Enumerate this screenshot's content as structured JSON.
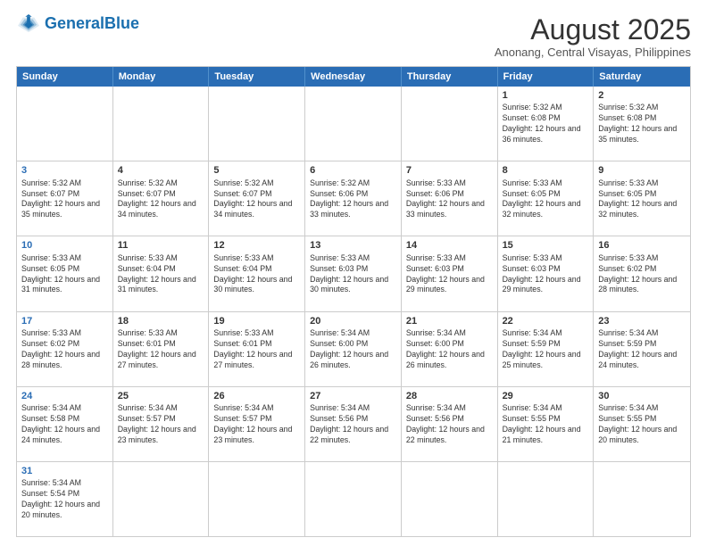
{
  "logo": {
    "text_general": "General",
    "text_blue": "Blue"
  },
  "header": {
    "month_year": "August 2025",
    "location": "Anonang, Central Visayas, Philippines"
  },
  "days_of_week": [
    "Sunday",
    "Monday",
    "Tuesday",
    "Wednesday",
    "Thursday",
    "Friday",
    "Saturday"
  ],
  "rows": [
    {
      "cells": [
        {
          "day": "",
          "info": ""
        },
        {
          "day": "",
          "info": ""
        },
        {
          "day": "",
          "info": ""
        },
        {
          "day": "",
          "info": ""
        },
        {
          "day": "",
          "info": ""
        },
        {
          "day": "1",
          "info": "Sunrise: 5:32 AM\nSunset: 6:08 PM\nDaylight: 12 hours and 36 minutes."
        },
        {
          "day": "2",
          "info": "Sunrise: 5:32 AM\nSunset: 6:08 PM\nDaylight: 12 hours and 35 minutes."
        }
      ]
    },
    {
      "cells": [
        {
          "day": "3",
          "info": "Sunrise: 5:32 AM\nSunset: 6:07 PM\nDaylight: 12 hours and 35 minutes."
        },
        {
          "day": "4",
          "info": "Sunrise: 5:32 AM\nSunset: 6:07 PM\nDaylight: 12 hours and 34 minutes."
        },
        {
          "day": "5",
          "info": "Sunrise: 5:32 AM\nSunset: 6:07 PM\nDaylight: 12 hours and 34 minutes."
        },
        {
          "day": "6",
          "info": "Sunrise: 5:32 AM\nSunset: 6:06 PM\nDaylight: 12 hours and 33 minutes."
        },
        {
          "day": "7",
          "info": "Sunrise: 5:33 AM\nSunset: 6:06 PM\nDaylight: 12 hours and 33 minutes."
        },
        {
          "day": "8",
          "info": "Sunrise: 5:33 AM\nSunset: 6:05 PM\nDaylight: 12 hours and 32 minutes."
        },
        {
          "day": "9",
          "info": "Sunrise: 5:33 AM\nSunset: 6:05 PM\nDaylight: 12 hours and 32 minutes."
        }
      ]
    },
    {
      "cells": [
        {
          "day": "10",
          "info": "Sunrise: 5:33 AM\nSunset: 6:05 PM\nDaylight: 12 hours and 31 minutes."
        },
        {
          "day": "11",
          "info": "Sunrise: 5:33 AM\nSunset: 6:04 PM\nDaylight: 12 hours and 31 minutes."
        },
        {
          "day": "12",
          "info": "Sunrise: 5:33 AM\nSunset: 6:04 PM\nDaylight: 12 hours and 30 minutes."
        },
        {
          "day": "13",
          "info": "Sunrise: 5:33 AM\nSunset: 6:03 PM\nDaylight: 12 hours and 30 minutes."
        },
        {
          "day": "14",
          "info": "Sunrise: 5:33 AM\nSunset: 6:03 PM\nDaylight: 12 hours and 29 minutes."
        },
        {
          "day": "15",
          "info": "Sunrise: 5:33 AM\nSunset: 6:03 PM\nDaylight: 12 hours and 29 minutes."
        },
        {
          "day": "16",
          "info": "Sunrise: 5:33 AM\nSunset: 6:02 PM\nDaylight: 12 hours and 28 minutes."
        }
      ]
    },
    {
      "cells": [
        {
          "day": "17",
          "info": "Sunrise: 5:33 AM\nSunset: 6:02 PM\nDaylight: 12 hours and 28 minutes."
        },
        {
          "day": "18",
          "info": "Sunrise: 5:33 AM\nSunset: 6:01 PM\nDaylight: 12 hours and 27 minutes."
        },
        {
          "day": "19",
          "info": "Sunrise: 5:33 AM\nSunset: 6:01 PM\nDaylight: 12 hours and 27 minutes."
        },
        {
          "day": "20",
          "info": "Sunrise: 5:34 AM\nSunset: 6:00 PM\nDaylight: 12 hours and 26 minutes."
        },
        {
          "day": "21",
          "info": "Sunrise: 5:34 AM\nSunset: 6:00 PM\nDaylight: 12 hours and 26 minutes."
        },
        {
          "day": "22",
          "info": "Sunrise: 5:34 AM\nSunset: 5:59 PM\nDaylight: 12 hours and 25 minutes."
        },
        {
          "day": "23",
          "info": "Sunrise: 5:34 AM\nSunset: 5:59 PM\nDaylight: 12 hours and 24 minutes."
        }
      ]
    },
    {
      "cells": [
        {
          "day": "24",
          "info": "Sunrise: 5:34 AM\nSunset: 5:58 PM\nDaylight: 12 hours and 24 minutes."
        },
        {
          "day": "25",
          "info": "Sunrise: 5:34 AM\nSunset: 5:57 PM\nDaylight: 12 hours and 23 minutes."
        },
        {
          "day": "26",
          "info": "Sunrise: 5:34 AM\nSunset: 5:57 PM\nDaylight: 12 hours and 23 minutes."
        },
        {
          "day": "27",
          "info": "Sunrise: 5:34 AM\nSunset: 5:56 PM\nDaylight: 12 hours and 22 minutes."
        },
        {
          "day": "28",
          "info": "Sunrise: 5:34 AM\nSunset: 5:56 PM\nDaylight: 12 hours and 22 minutes."
        },
        {
          "day": "29",
          "info": "Sunrise: 5:34 AM\nSunset: 5:55 PM\nDaylight: 12 hours and 21 minutes."
        },
        {
          "day": "30",
          "info": "Sunrise: 5:34 AM\nSunset: 5:55 PM\nDaylight: 12 hours and 20 minutes."
        }
      ]
    },
    {
      "cells": [
        {
          "day": "31",
          "info": "Sunrise: 5:34 AM\nSunset: 5:54 PM\nDaylight: 12 hours and 20 minutes."
        },
        {
          "day": "",
          "info": ""
        },
        {
          "day": "",
          "info": ""
        },
        {
          "day": "",
          "info": ""
        },
        {
          "day": "",
          "info": ""
        },
        {
          "day": "",
          "info": ""
        },
        {
          "day": "",
          "info": ""
        }
      ]
    }
  ]
}
